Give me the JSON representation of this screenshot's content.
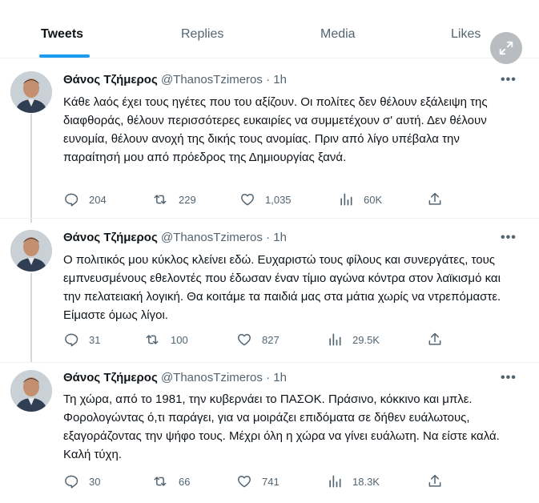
{
  "tabs": [
    {
      "label": "Tweets",
      "active": true
    },
    {
      "label": "Replies",
      "active": false
    },
    {
      "label": "Media",
      "active": false
    },
    {
      "label": "Likes",
      "active": false
    }
  ],
  "tweets": [
    {
      "name": "Θάνος Τζήμερος",
      "handle": "@ThanosTzimeros",
      "separator": "·",
      "time": "1h",
      "more": "•••",
      "text": "Κάθε λαός έχει τους ηγέτες που του αξίζουν. Οι πολίτες δεν θέλουν εξάλειψη της διαφθοράς, θέλουν περισσότερες ευκαιρίες να συμμετέχουν σ' αυτή. Δεν θέλουν ευνομία, θέλουν ανοχή της δικής τους ανομίας. Πριν από λίγο υπέβαλα την παραίτησή μου από πρόεδρος της Δημιουργίας ξανά.",
      "replies": "204",
      "retweets": "229",
      "likes": "1,035",
      "views": "60K"
    },
    {
      "name": "Θάνος Τζήμερος",
      "handle": "@ThanosTzimeros",
      "separator": "·",
      "time": "1h",
      "more": "•••",
      "text": "Ο πολιτικός μου κύκλος κλείνει εδώ. Ευχαριστώ τους φίλους και συνεργάτες, τους εμπνευσμένους εθελοντές που έδωσαν έναν τίμιο αγώνα κόντρα στον λαϊκισμό και την πελατειακή λογική. Θα κοιτάμε τα παιδιά μας στα μάτια χωρίς να ντρεπόμαστε. Είμαστε όμως λίγοι.",
      "replies": "31",
      "retweets": "100",
      "likes": "827",
      "views": "29.5K"
    },
    {
      "name": "Θάνος Τζήμερος",
      "handle": "@ThanosTzimeros",
      "separator": "·",
      "time": "1h",
      "more": "•••",
      "text": "Τη χώρα, από το 1981, την κυβερνάει το ΠΑΣΟΚ. Πράσινο, κόκκινο και μπλε. Φορολογώντας ό,τι παράγει, για να μοιράζει επιδόματα σε δήθεν ευάλωτους, εξαγοράζοντας την ψήφο τους. Μέχρι όλη η χώρα να γίνει ευάλωτη. Να είστε καλά. Καλή τύχη.",
      "replies": "30",
      "retweets": "66",
      "likes": "741",
      "views": "18.3K"
    }
  ],
  "colors": {
    "accent": "#1d9bf0",
    "text_primary": "#0f1419",
    "text_secondary": "#536471",
    "divider": "#eff3f4",
    "thread_line": "#cfd9de"
  },
  "icons": [
    "expand-icon",
    "reply-icon",
    "retweet-icon",
    "like-icon",
    "views-icon",
    "share-icon",
    "more-icon"
  ]
}
